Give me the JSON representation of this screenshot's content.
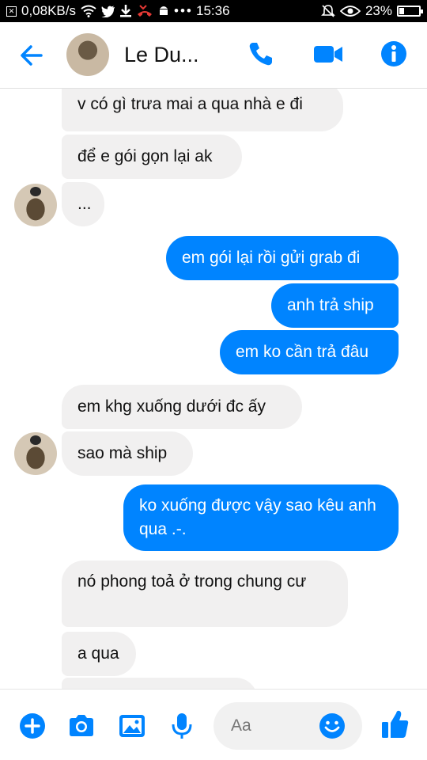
{
  "status_bar": {
    "network_speed": "0,08KB/s",
    "time": "15:36",
    "battery": "23%",
    "left_icons": [
      "notification-box-icon",
      "wifi-icon",
      "twitter-icon",
      "download-icon",
      "missed-call-icon",
      "android-icon",
      "more-dots-icon"
    ],
    "right_icons": [
      "silent-icon",
      "eye-icon",
      "battery-icon"
    ]
  },
  "header": {
    "contact_name": "Le Du...",
    "icons": [
      "back-arrow-icon",
      "phone-icon",
      "video-call-icon",
      "info-icon"
    ],
    "accent": "#0084ff"
  },
  "messages": [
    {
      "side": "in",
      "text": "v có gì trưa mai a qua nhà e đi"
    },
    {
      "side": "in",
      "text": "để e gói gọn lại ak"
    },
    {
      "side": "in",
      "text": "..."
    },
    {
      "side": "out",
      "text": "em gói lại rồi gửi grab đi"
    },
    {
      "side": "out",
      "text": "anh trả ship"
    },
    {
      "side": "out",
      "text": "em ko cần trả đâu"
    },
    {
      "side": "in",
      "text": "em khg xuống dưới đc ấy"
    },
    {
      "side": "in",
      "text": "sao mà ship"
    },
    {
      "side": "out",
      "text": "ko xuống được vậy sao kêu anh qua .-."
    },
    {
      "side": "in",
      "text": "nó phong toả ở trong chung cư"
    },
    {
      "side": "in",
      "text": "a qua"
    }
  ],
  "composer": {
    "placeholder": "Aa",
    "icons": [
      "plus-icon",
      "camera-icon",
      "gallery-icon",
      "mic-icon",
      "emoji-icon",
      "like-icon"
    ]
  },
  "colors": {
    "outgoing_bubble": "#0084ff",
    "incoming_bubble": "#f1f0f0"
  }
}
